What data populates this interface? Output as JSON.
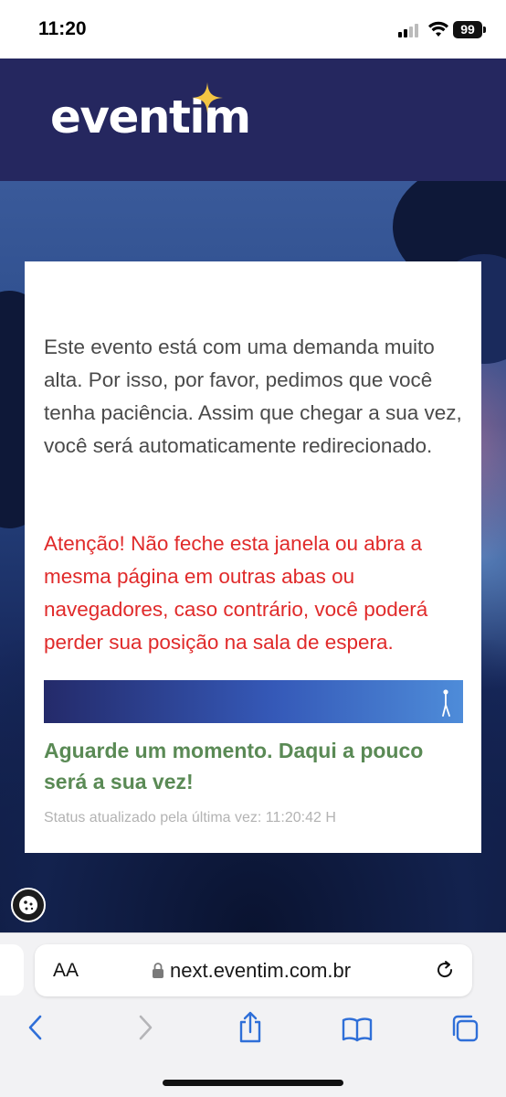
{
  "status_bar": {
    "time": "11:20",
    "battery": "99"
  },
  "header": {
    "logo_text": "eventim"
  },
  "card": {
    "intro": "Este evento está com uma demanda muito alta. Por isso, por favor, pedimos que você tenha paciência. Assim que chegar a sua vez, você será automaticamente redirecionado.",
    "warning": "Atenção! Não feche esta janela ou abra a mesma página em outras abas ou navegadores, caso contrário, você poderá perder sua posição na sala de espera.",
    "wait_message": "Aguarde um momento. Daqui a pouco será a sua vez!",
    "status_updated": "Status atualizado pela última vez: 11:20:42 H"
  },
  "browser": {
    "text_size_label": "AA",
    "url": "next.eventim.com.br"
  },
  "icons": [
    "signal-icon",
    "wifi-icon",
    "battery-icon",
    "sparkle-icon",
    "walker-icon",
    "cookie-icon",
    "lock-icon",
    "reload-icon",
    "back-icon",
    "forward-icon",
    "share-icon",
    "bookmarks-icon",
    "tabs-icon"
  ],
  "colors": {
    "header": "#25275f",
    "warning": "#e02a2a",
    "wait": "#5a8a55",
    "accent": "#2f6fd8"
  }
}
